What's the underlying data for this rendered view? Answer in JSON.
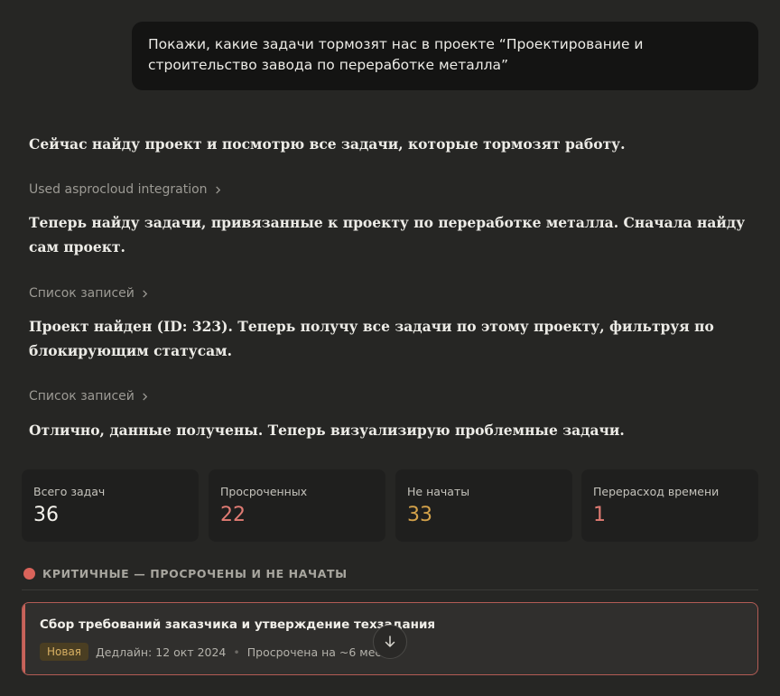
{
  "user_message": "Покажи, какие задачи тормозят нас в проекте “Проектирование и строительство завода по переработке металла”",
  "assistant": {
    "para1": "Сейчас найду проект и посмотрю все задачи, которые тормозят работу.",
    "tool1": "Used asprocloud integration",
    "para2": "Теперь найду задачи, привязанные к проекту по переработке металла. Сначала найду сам проект.",
    "tool2": "Список записей",
    "para3": "Проект найден (ID: 323). Теперь получу все задачи по этому проекту, фильтруя по блокирующим статусам.",
    "tool3": "Список записей",
    "para4": "Отлично, данные получены. Теперь визуализирую проблемные задачи."
  },
  "stats": [
    {
      "label": "Всего задач",
      "value": "36",
      "color": "#f4f2ec"
    },
    {
      "label": "Просроченных",
      "value": "22",
      "color": "#e07b73"
    },
    {
      "label": "Не начаты",
      "value": "33",
      "color": "#d4a24a"
    },
    {
      "label": "Перерасход времени",
      "value": "1",
      "color": "#e07b73"
    }
  ],
  "section": {
    "title": "КРИТИЧНЫЕ — ПРОСРОЧЕНЫ И НЕ НАЧАТЫ",
    "dot_color": "#d9635a"
  },
  "task": {
    "title": "Сбор требований заказчика и утверждение техзадания",
    "badge": "Новая",
    "deadline": "Дедлайн: 12 окт 2024",
    "separator": "•",
    "overdue": "Просрочена на ~6 мес"
  },
  "icons": {
    "tool_chevron": "chevron-right-icon",
    "scroll": "arrow-down-icon"
  }
}
